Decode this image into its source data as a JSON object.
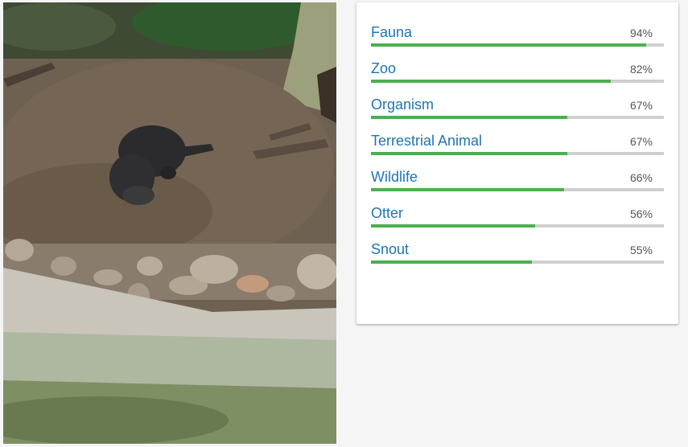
{
  "photo": {
    "alt_icon": "otter-photo"
  },
  "labels": [
    {
      "name": "Fauna",
      "score": "94%",
      "fraction": 0.94
    },
    {
      "name": "Zoo",
      "score": "82%",
      "fraction": 0.82
    },
    {
      "name": "Organism",
      "score": "67%",
      "fraction": 0.67
    },
    {
      "name": "Terrestrial Animal",
      "score": "67%",
      "fraction": 0.67
    },
    {
      "name": "Wildlife",
      "score": "66%",
      "fraction": 0.66
    },
    {
      "name": "Otter",
      "score": "56%",
      "fraction": 0.56
    },
    {
      "name": "Snout",
      "score": "55%",
      "fraction": 0.55
    }
  ],
  "colors": {
    "label_text": "#1f74b4",
    "bar_fill": "#4caf50",
    "bar_track": "#cfcfcf"
  }
}
